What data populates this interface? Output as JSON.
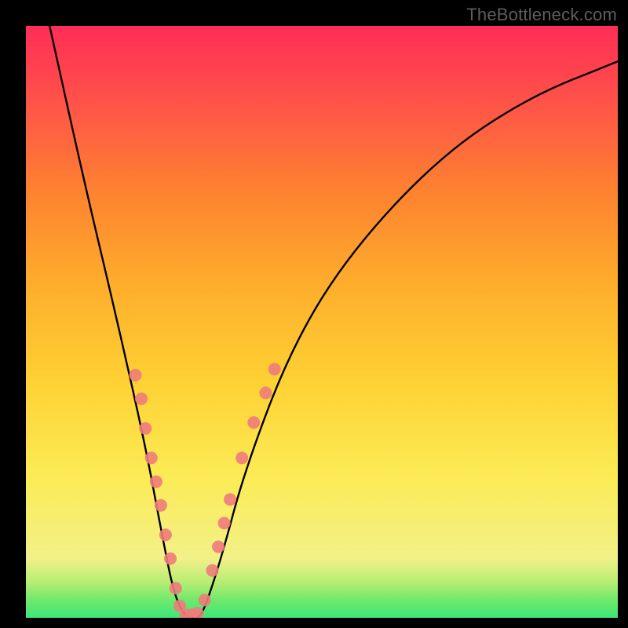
{
  "watermark": "TheBottleneck.com",
  "chart_data": {
    "type": "line",
    "title": "",
    "xlabel": "",
    "ylabel": "",
    "xlim": [
      0,
      100
    ],
    "ylim": [
      0,
      100
    ],
    "note": "V-shaped bottleneck curve over rainbow gradient; axes unlabeled; values estimated from shape",
    "series": [
      {
        "name": "curve",
        "x": [
          4,
          10,
          15,
          20,
          23,
          25,
          27,
          29,
          30,
          33,
          37,
          45,
          55,
          70,
          85,
          100
        ],
        "y": [
          100,
          73,
          52,
          30,
          14,
          4,
          0,
          0,
          1,
          10,
          25,
          46,
          62,
          78,
          88,
          94
        ]
      }
    ],
    "markers": [
      {
        "x": 18.5,
        "y": 41
      },
      {
        "x": 19.5,
        "y": 37
      },
      {
        "x": 20.2,
        "y": 32
      },
      {
        "x": 21.2,
        "y": 27
      },
      {
        "x": 22.0,
        "y": 23
      },
      {
        "x": 22.8,
        "y": 19
      },
      {
        "x": 23.6,
        "y": 14
      },
      {
        "x": 24.4,
        "y": 10
      },
      {
        "x": 25.3,
        "y": 5
      },
      {
        "x": 26.0,
        "y": 2
      },
      {
        "x": 27.0,
        "y": 0.5
      },
      {
        "x": 28.0,
        "y": 0.5
      },
      {
        "x": 29.0,
        "y": 0.8
      },
      {
        "x": 30.2,
        "y": 3
      },
      {
        "x": 31.5,
        "y": 8
      },
      {
        "x": 32.5,
        "y": 12
      },
      {
        "x": 33.5,
        "y": 16
      },
      {
        "x": 34.5,
        "y": 20
      },
      {
        "x": 36.5,
        "y": 27
      },
      {
        "x": 38.5,
        "y": 33
      },
      {
        "x": 40.5,
        "y": 38
      },
      {
        "x": 42.0,
        "y": 42
      }
    ],
    "colors": {
      "curve": "#000000",
      "marker": "#f07b7b"
    }
  }
}
